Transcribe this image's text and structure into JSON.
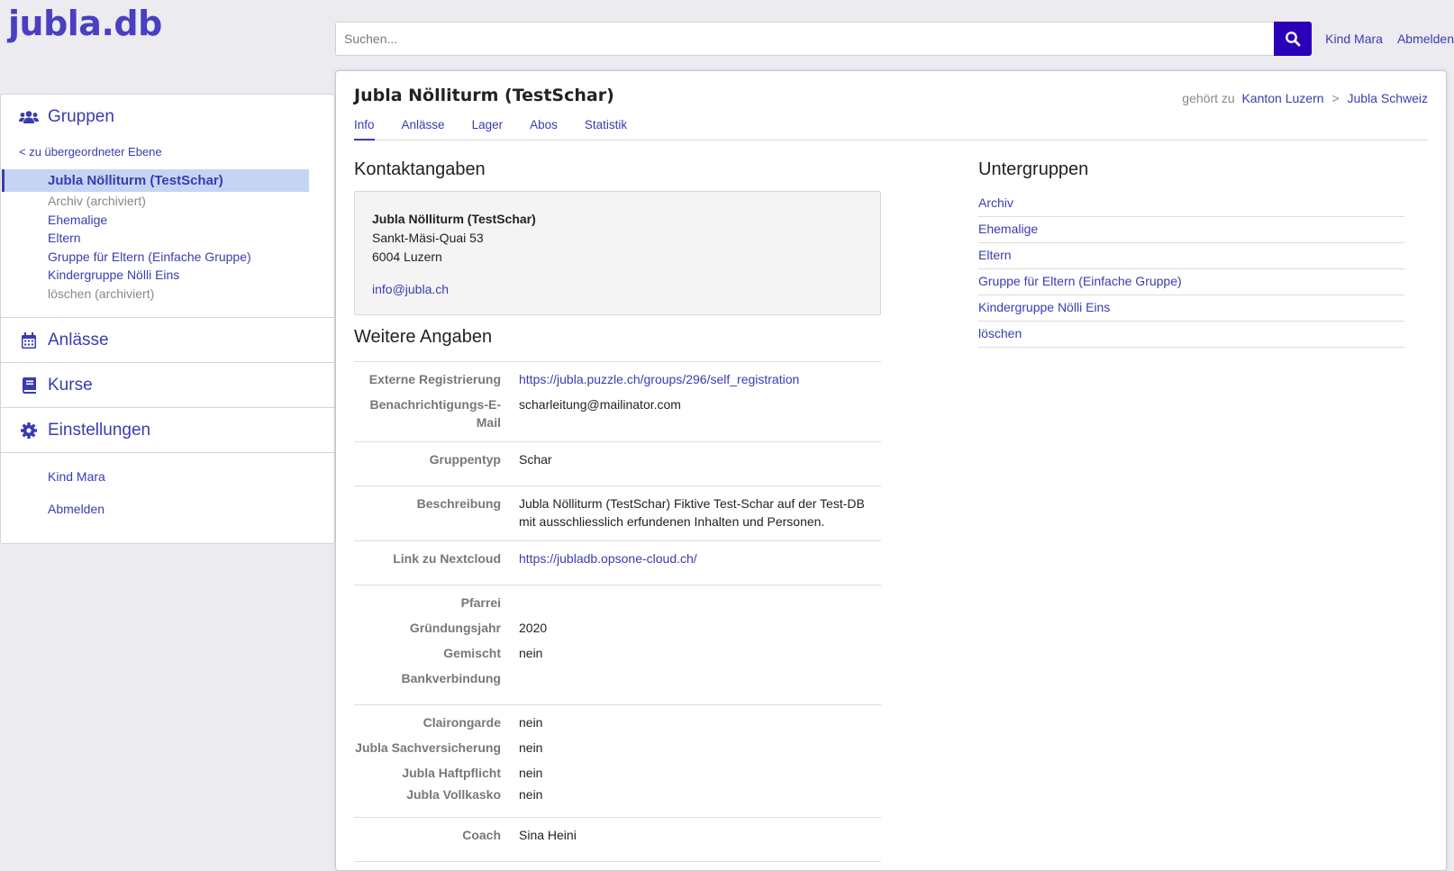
{
  "app": {
    "logo": "jubla.db"
  },
  "search": {
    "placeholder": "Suchen..."
  },
  "topnav": {
    "user": "Kind Mara",
    "logout": "Abmelden"
  },
  "sidebar": {
    "groups_label": "Gruppen",
    "up_link": "< zu übergeordneter Ebene",
    "current_group": "Jubla Nölliturm (TestSchar)",
    "subgroups": [
      {
        "label": "Archiv (archiviert)",
        "archived": true
      },
      {
        "label": "Ehemalige",
        "archived": false
      },
      {
        "label": "Eltern",
        "archived": false
      },
      {
        "label": "Gruppe für Eltern (Einfache Gruppe)",
        "archived": false
      },
      {
        "label": "Kindergruppe Nölli Eins",
        "archived": false
      },
      {
        "label": "löschen (archiviert)",
        "archived": true
      }
    ],
    "sections": {
      "events": "Anlässe",
      "courses": "Kurse",
      "settings": "Einstellungen"
    },
    "footer": {
      "user": "Kind Mara",
      "logout": "Abmelden"
    }
  },
  "main": {
    "title": "Jubla Nölliturm (TestSchar)",
    "belongs_to": {
      "label": "gehört zu",
      "level1": "Kanton Luzern",
      "separator": ">",
      "level2": "Jubla Schweiz"
    },
    "tabs": [
      "Info",
      "Anlässe",
      "Lager",
      "Abos",
      "Statistik"
    ],
    "contact": {
      "heading": "Kontaktangaben",
      "name": "Jubla Nölliturm (TestSchar)",
      "street": "Sankt-Mäsi-Quai 53",
      "city": "6004 Luzern",
      "email": "info@jubla.ch"
    },
    "details": {
      "heading": "Weitere Angaben",
      "external_registration_label": "Externe Registrierung",
      "external_registration_value": "https://jubla.puzzle.ch/groups/296/self_registration",
      "notification_email_label": "Benachrichtigungs-E-Mail",
      "notification_email_value": "scharleitung@mailinator.com",
      "group_type_label": "Gruppentyp",
      "group_type_value": "Schar",
      "description_label": "Beschreibung",
      "description_value": "Jubla Nölliturm (TestSchar) Fiktive Test-Schar auf der Test-DB mit ausschliesslich erfundenen Inhalten und Personen.",
      "nextcloud_label": "Link zu Nextcloud",
      "nextcloud_value": "https://jubladb.opsone-cloud.ch/",
      "parish_label": "Pfarrei",
      "parish_value": "",
      "founding_year_label": "Gründungsjahr",
      "founding_year_value": "2020",
      "mixed_label": "Gemischt",
      "mixed_value": "nein",
      "bank_label": "Bankverbindung",
      "bank_value": "",
      "clairongarde_label": "Clairongarde",
      "clairongarde_value": "nein",
      "property_insurance_label": "Jubla Sachversicherung",
      "property_insurance_value": "nein",
      "liability_label": "Jubla Haftpflicht",
      "liability_value": "nein",
      "comprehensive_label": "Jubla Vollkasko",
      "comprehensive_value": "nein",
      "coach_label": "Coach",
      "coach_value": "Sina Heini"
    },
    "subgroups": {
      "heading": "Untergruppen",
      "items": [
        "Archiv",
        "Ehemalige",
        "Eltern",
        "Gruppe für Eltern (Einfache Gruppe)",
        "Kindergruppe Nölli Eins",
        "löschen"
      ]
    }
  },
  "colors": {
    "brand": "#4a3fc0",
    "link": "#3b3bb0",
    "search_button": "#2a00b8",
    "active_item_bg": "#c6d4f4"
  }
}
